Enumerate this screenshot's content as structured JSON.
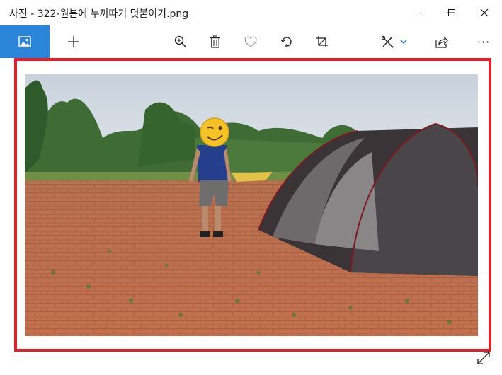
{
  "window": {
    "title": "사진 - 322-원본에 누끼따기 덧붙이기.png",
    "controls": [
      "minimize-icon",
      "maximize-icon",
      "close-icon"
    ]
  },
  "toolbar": {
    "items": [
      {
        "name": "view-image-icon",
        "active": true
      },
      {
        "name": "add-icon"
      },
      {
        "name": "zoom-icon"
      },
      {
        "name": "delete-icon"
      },
      {
        "name": "favorite-icon"
      },
      {
        "name": "rotate-icon"
      },
      {
        "name": "crop-icon"
      },
      {
        "name": "edit-draw-icon"
      },
      {
        "name": "dropdown-chevron-icon"
      },
      {
        "name": "share-icon"
      },
      {
        "name": "more-icon"
      }
    ],
    "active_color": "#2b86d9",
    "more_label": "···"
  },
  "viewer": {
    "frame_color": "#e0202a",
    "photo": {
      "description_icon": "photo-camping-tent",
      "face_overlay": "wink-emoji"
    },
    "expand_control": "expand-icon"
  }
}
